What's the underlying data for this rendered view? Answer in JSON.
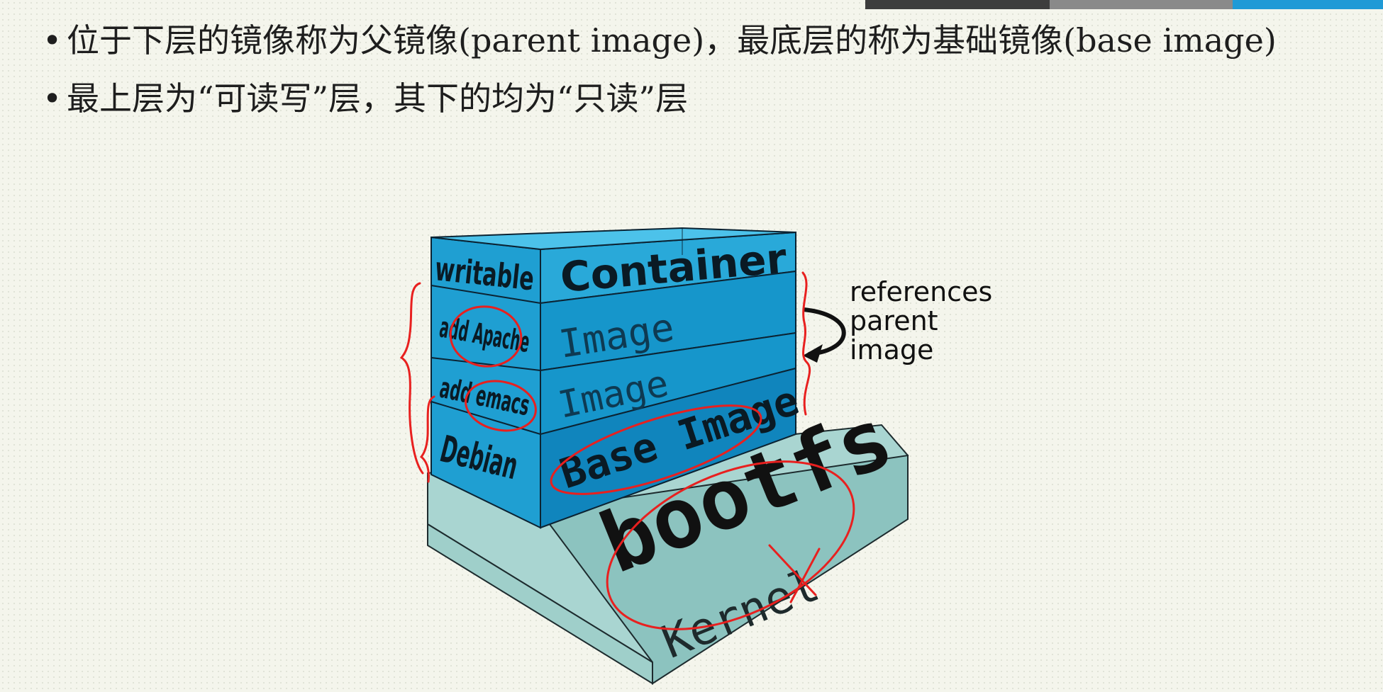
{
  "slide": {
    "bullets": [
      {
        "text": "位于下层的镜像称为父镜像(parent image)，最底层的称为基础镜像(base image)"
      },
      {
        "text": "最上层为“可读写”层，其下的均为“只读”层"
      }
    ]
  },
  "diagram": {
    "layers": [
      {
        "left_label": "writable",
        "right_label": "Container"
      },
      {
        "left_label": "add Apache",
        "right_label": "Image"
      },
      {
        "left_label": "add emacs",
        "right_label": "Image"
      },
      {
        "left_label": "Debian",
        "right_label": "Base Image"
      }
    ],
    "bootfs_label": "bootfs",
    "kernel_label": "Kernel",
    "references_label": "references\nparent\nimage"
  },
  "colors": {
    "container_top": "#3bb6e3",
    "container_front": "#29a9d9",
    "image_front": "#1696cb",
    "base_front": "#1085bd",
    "side_dark": "#0f77a8",
    "bootfs_slab": "#a9d5d1",
    "bootfs_slab_dark": "#8cc3bf",
    "annotation_red": "#e8201f",
    "topbar": [
      "#3d3d3d",
      "#8a8a8a",
      "#1f9ad6"
    ]
  }
}
